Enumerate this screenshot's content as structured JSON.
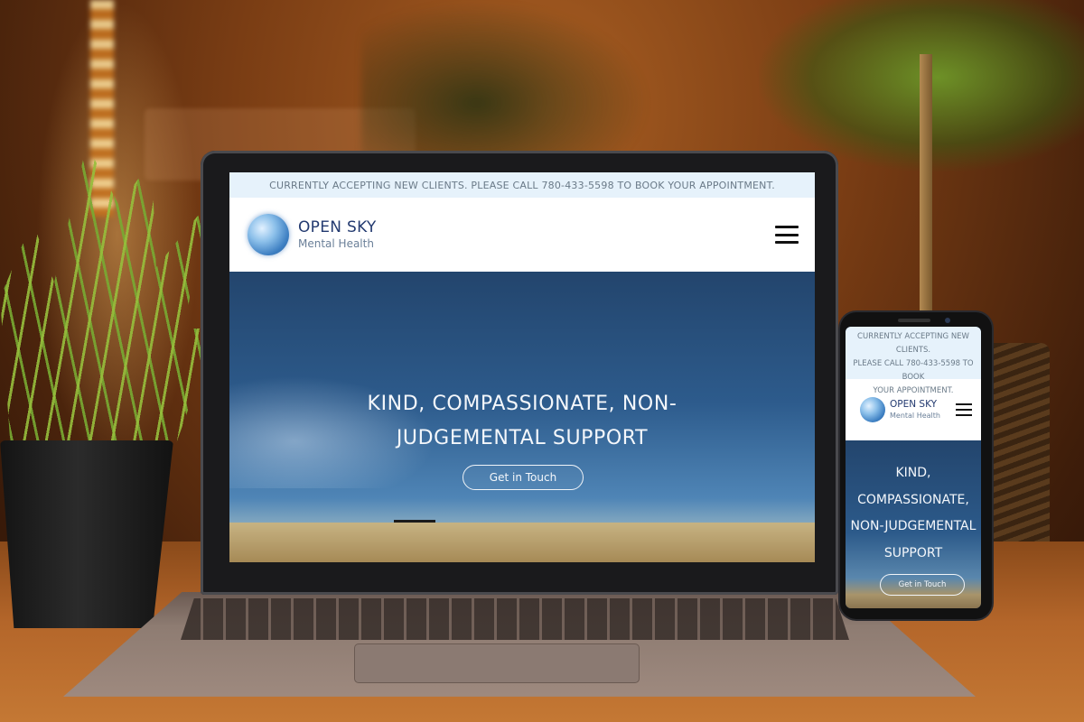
{
  "laptop_site": {
    "banner": "CURRENTLY ACCEPTING NEW CLIENTS. PLEASE CALL 780-433-5598 TO BOOK YOUR APPOINTMENT.",
    "brand_top": "OPEN SKY",
    "brand_bottom": "Mental  Health",
    "hero_line1": "KIND, COMPASSIONATE, NON-",
    "hero_line2": "JUDGEMENTAL SUPPORT",
    "cta": "Get in Touch",
    "menu_icon": "hamburger-menu-icon"
  },
  "phone_site": {
    "banner_line1": "CURRENTLY ACCEPTING NEW CLIENTS.",
    "banner_line2": "PLEASE CALL 780-433-5598 TO BOOK",
    "banner_line3": "YOUR APPOINTMENT.",
    "brand_top": "OPEN SKY",
    "brand_bottom": "Mental  Health",
    "hero_line1": "KIND,",
    "hero_line2": "COMPASSIONATE,",
    "hero_line3": "NON-JUDGEMENTAL",
    "hero_line4": "SUPPORT",
    "cta": "Get in Touch",
    "menu_icon": "hamburger-menu-icon"
  },
  "colors": {
    "banner_bg": "#e6f2fb",
    "brand_text": "#233a70",
    "hero_sky": "#2d5b8c"
  }
}
